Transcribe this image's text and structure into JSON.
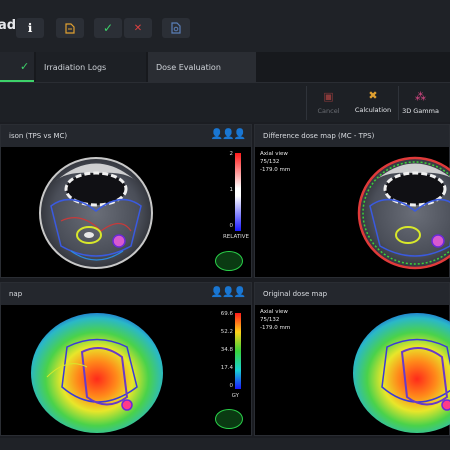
{
  "window": {
    "title_fragment": "ad"
  },
  "header_buttons": [
    {
      "name": "info-icon",
      "glyph": "ℹ",
      "color": "#ffffff"
    },
    {
      "name": "document-icon",
      "glyph": "▤",
      "color": "#e0a030"
    },
    {
      "name": "check-icon",
      "glyph": "✓",
      "color": "#3dd26a"
    },
    {
      "name": "close-icon",
      "glyph": "✕",
      "color": "#e04040"
    },
    {
      "name": "file-search-icon",
      "glyph": "⎙",
      "color": "#5a7fb8"
    }
  ],
  "tabs": [
    {
      "label": "",
      "status_glyph": "✓"
    },
    {
      "label": "Irradiation Logs"
    },
    {
      "label": "Dose Evaluation"
    }
  ],
  "toolbar": {
    "cancel": "Cancel",
    "calculation": "Calculation",
    "gamma": "3D Gamma"
  },
  "panels": {
    "top_left": {
      "title": "ison (TPS vs MC)",
      "scale_label": "RELATIVE",
      "scale_max": "2",
      "scale_mid": "1",
      "scale_min": "0"
    },
    "top_right": {
      "title": "Difference dose map (MC - TPS)",
      "view": "Axial view",
      "slice": "75/132",
      "position": "-179.0 mm"
    },
    "bottom_left": {
      "title": "nap",
      "scale_label": "GY",
      "ticks": [
        "69.6",
        "52.2",
        "34.8",
        "17.4",
        "0"
      ]
    },
    "bottom_right": {
      "title": "Original dose map",
      "view": "Axial view",
      "slice": "75/132",
      "position": "-179.0 mm"
    }
  },
  "colors": {
    "accent_green": "#3dd26a",
    "panel_header": "#24272d",
    "background": "#1b1d22"
  }
}
